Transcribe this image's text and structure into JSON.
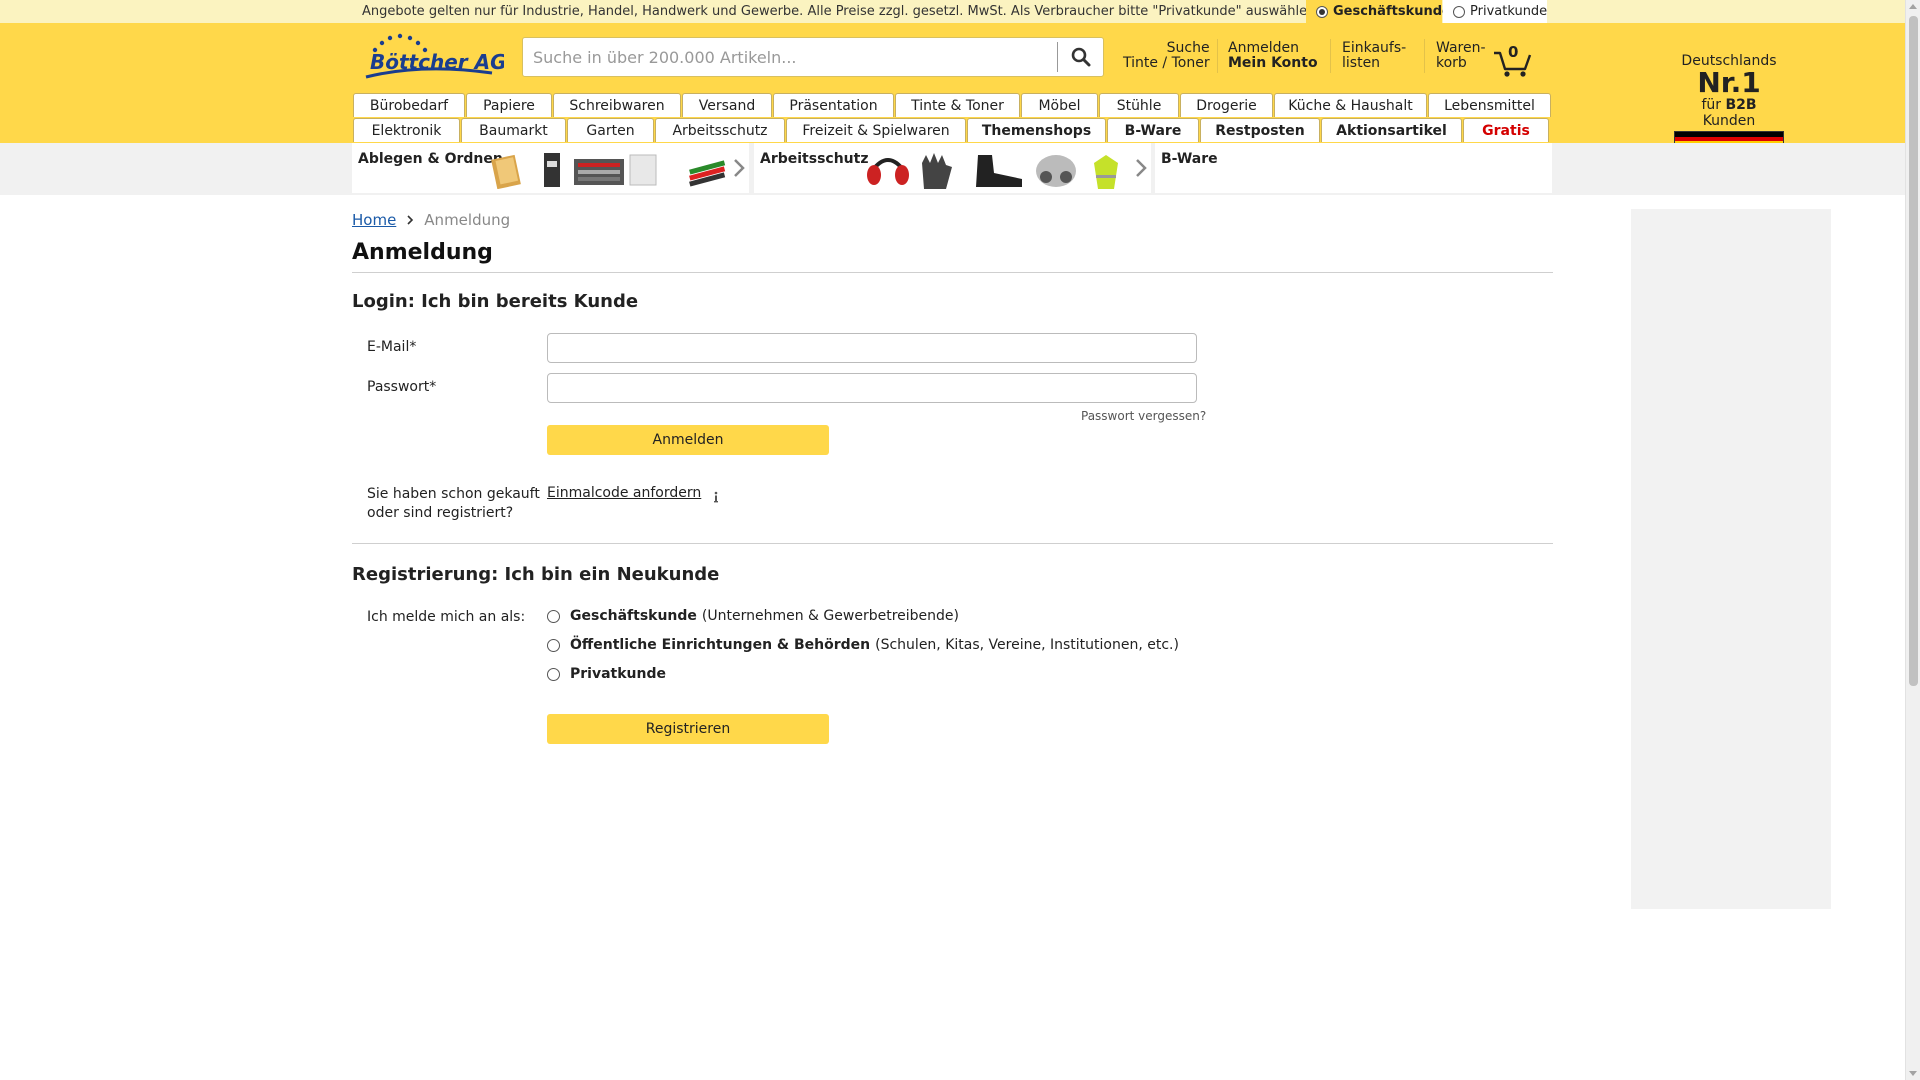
{
  "topbar": {
    "notice": "Angebote gelten nur für Industrie, Handel, Handwerk und Gewerbe. Alle Preise zzgl. gesetzl. MwSt. Als Verbraucher bitte \"Privatkunde\" auswählen.",
    "customer_types": [
      {
        "label": "Geschäftskunde",
        "selected": true
      },
      {
        "label": "Privatkunde",
        "selected": false
      }
    ]
  },
  "header": {
    "logo_text": "Böttcher AG",
    "search_placeholder": "Suche in über 200.000 Artikeln...",
    "links": [
      {
        "line1": "Suche",
        "line2": "Tinte / Toner"
      },
      {
        "line1": "Anmelden",
        "line2": "Mein Konto"
      },
      {
        "line1": "Einkaufs-",
        "line2": "listen"
      },
      {
        "line1": "Waren-",
        "line2": "korb"
      }
    ],
    "cart_count": "0",
    "badge": {
      "top": "Deutschlands",
      "big": "Nr.1",
      "sub_prefix": "für",
      "sub_bold": "B2B",
      "sub_suffix": "Kunden"
    }
  },
  "nav": {
    "row1": [
      "Bürobedarf",
      "Papiere",
      "Schreibwaren",
      "Versand",
      "Präsentation",
      "Tinte & Toner",
      "Möbel",
      "Stühle",
      "Drogerie",
      "Küche & Haushalt",
      "Lebensmittel"
    ],
    "row2": [
      "Elektronik",
      "Baumarkt",
      "Garten",
      "Arbeitsschutz",
      "Freizeit & Spielwaren",
      "Themenshops",
      "B-Ware",
      "Restposten",
      "Aktionsartikel",
      "Gratis"
    ]
  },
  "category_strip": [
    {
      "title": "Ablegen & Ordnen"
    },
    {
      "title": "Arbeitsschutz"
    },
    {
      "title": "B-Ware"
    }
  ],
  "breadcrumb": {
    "home": "Home",
    "current": "Anmeldung"
  },
  "page_title": "Anmeldung",
  "login": {
    "title": "Login: Ich bin bereits Kunde",
    "email_label": "E-Mail*",
    "email_value": "",
    "password_label": "Passwort*",
    "password_value": "",
    "forgot": "Passwort vergessen?",
    "submit": "Anmelden",
    "onetime_label_1": "Sie haben schon gekauft",
    "onetime_label_2": "oder sind registriert?",
    "onetime_link": "Einmalcode anfordern"
  },
  "register": {
    "title": "Registrierung: Ich bin ein Neukunde",
    "as_label": "Ich melde mich an als:",
    "options": [
      {
        "bold": "Geschäftskunde",
        "detail": "(Unternehmen & Gewerbetreibende)"
      },
      {
        "bold": "Öffentliche Einrichtungen & Behörden",
        "detail": "(Schulen, Kitas, Vereine, Institutionen, etc.)"
      },
      {
        "bold": "Privatkunde",
        "detail": ""
      }
    ],
    "submit": "Registrieren"
  },
  "colors": {
    "brand_yellow": "#ffd84a",
    "topbar": "#fbf3c0",
    "link_blue": "#1a5aa8",
    "gratis_red": "#d40000"
  }
}
